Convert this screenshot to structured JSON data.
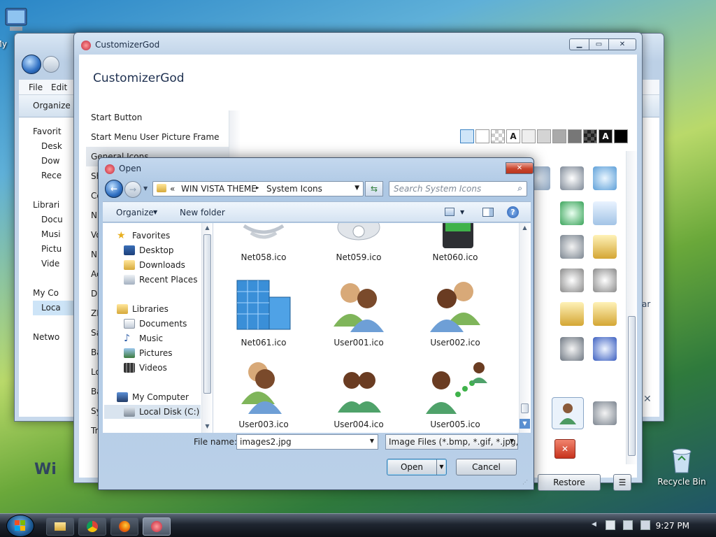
{
  "desktop": {
    "icons": [
      {
        "label": "My",
        "icon": "computer-icon"
      },
      {
        "label": "Recycle Bin",
        "icon": "recycle-bin-icon"
      }
    ]
  },
  "explorer": {
    "menu": [
      "File",
      "Edit"
    ],
    "organize_label": "Organize",
    "nav": [
      "Favorit",
      "Desk",
      "Dow",
      "Rece",
      "Librari",
      "Docu",
      "Musi",
      "Pictu",
      "Vide",
      "My Co",
      "Loca",
      "Netwo"
    ],
    "brand": "Wi"
  },
  "customizer": {
    "title": "CustomizerGod",
    "heading": "CustomizerGod",
    "list": [
      "Start Button",
      "Start Menu User Picture Frame",
      "General Icons",
      "Sh",
      "Co",
      "N",
      "Vo",
      "N",
      "Ac",
      "D",
      "ZI",
      "Sa",
      "Ba",
      "Lo",
      "Ba",
      "Sy",
      "Tr"
    ],
    "swatch_letter_a": "A",
    "restore_label": "Restore",
    "right_partial_text": "ar"
  },
  "dialog": {
    "title": "Open",
    "breadcrumb_prefix": "«",
    "breadcrumb": [
      "WIN VISTA THEME",
      "System Icons"
    ],
    "search_placeholder": "Search System Icons",
    "toolbar": {
      "organize": "Organize",
      "new_folder": "New folder"
    },
    "nav": {
      "favorites": "Favorites",
      "favorites_items": [
        "Desktop",
        "Downloads",
        "Recent Places"
      ],
      "libraries": "Libraries",
      "libraries_items": [
        "Documents",
        "Music",
        "Pictures",
        "Videos"
      ],
      "computer": "My Computer",
      "computer_items": [
        "Local Disk (C:)"
      ]
    },
    "files": [
      "Net058.ico",
      "Net059.ico",
      "Net060.ico",
      "Net061.ico",
      "User001.ico",
      "User002.ico",
      "User003.ico",
      "User004.ico",
      "User005.ico"
    ],
    "file_name_label": "File name:",
    "file_name_value": "images2.jpg",
    "file_type_value": "Image Files (*.bmp, *.gif, *.jpg,",
    "open_label": "Open",
    "cancel_label": "Cancel"
  },
  "taskbar": {
    "clock": "9:27 PM"
  }
}
